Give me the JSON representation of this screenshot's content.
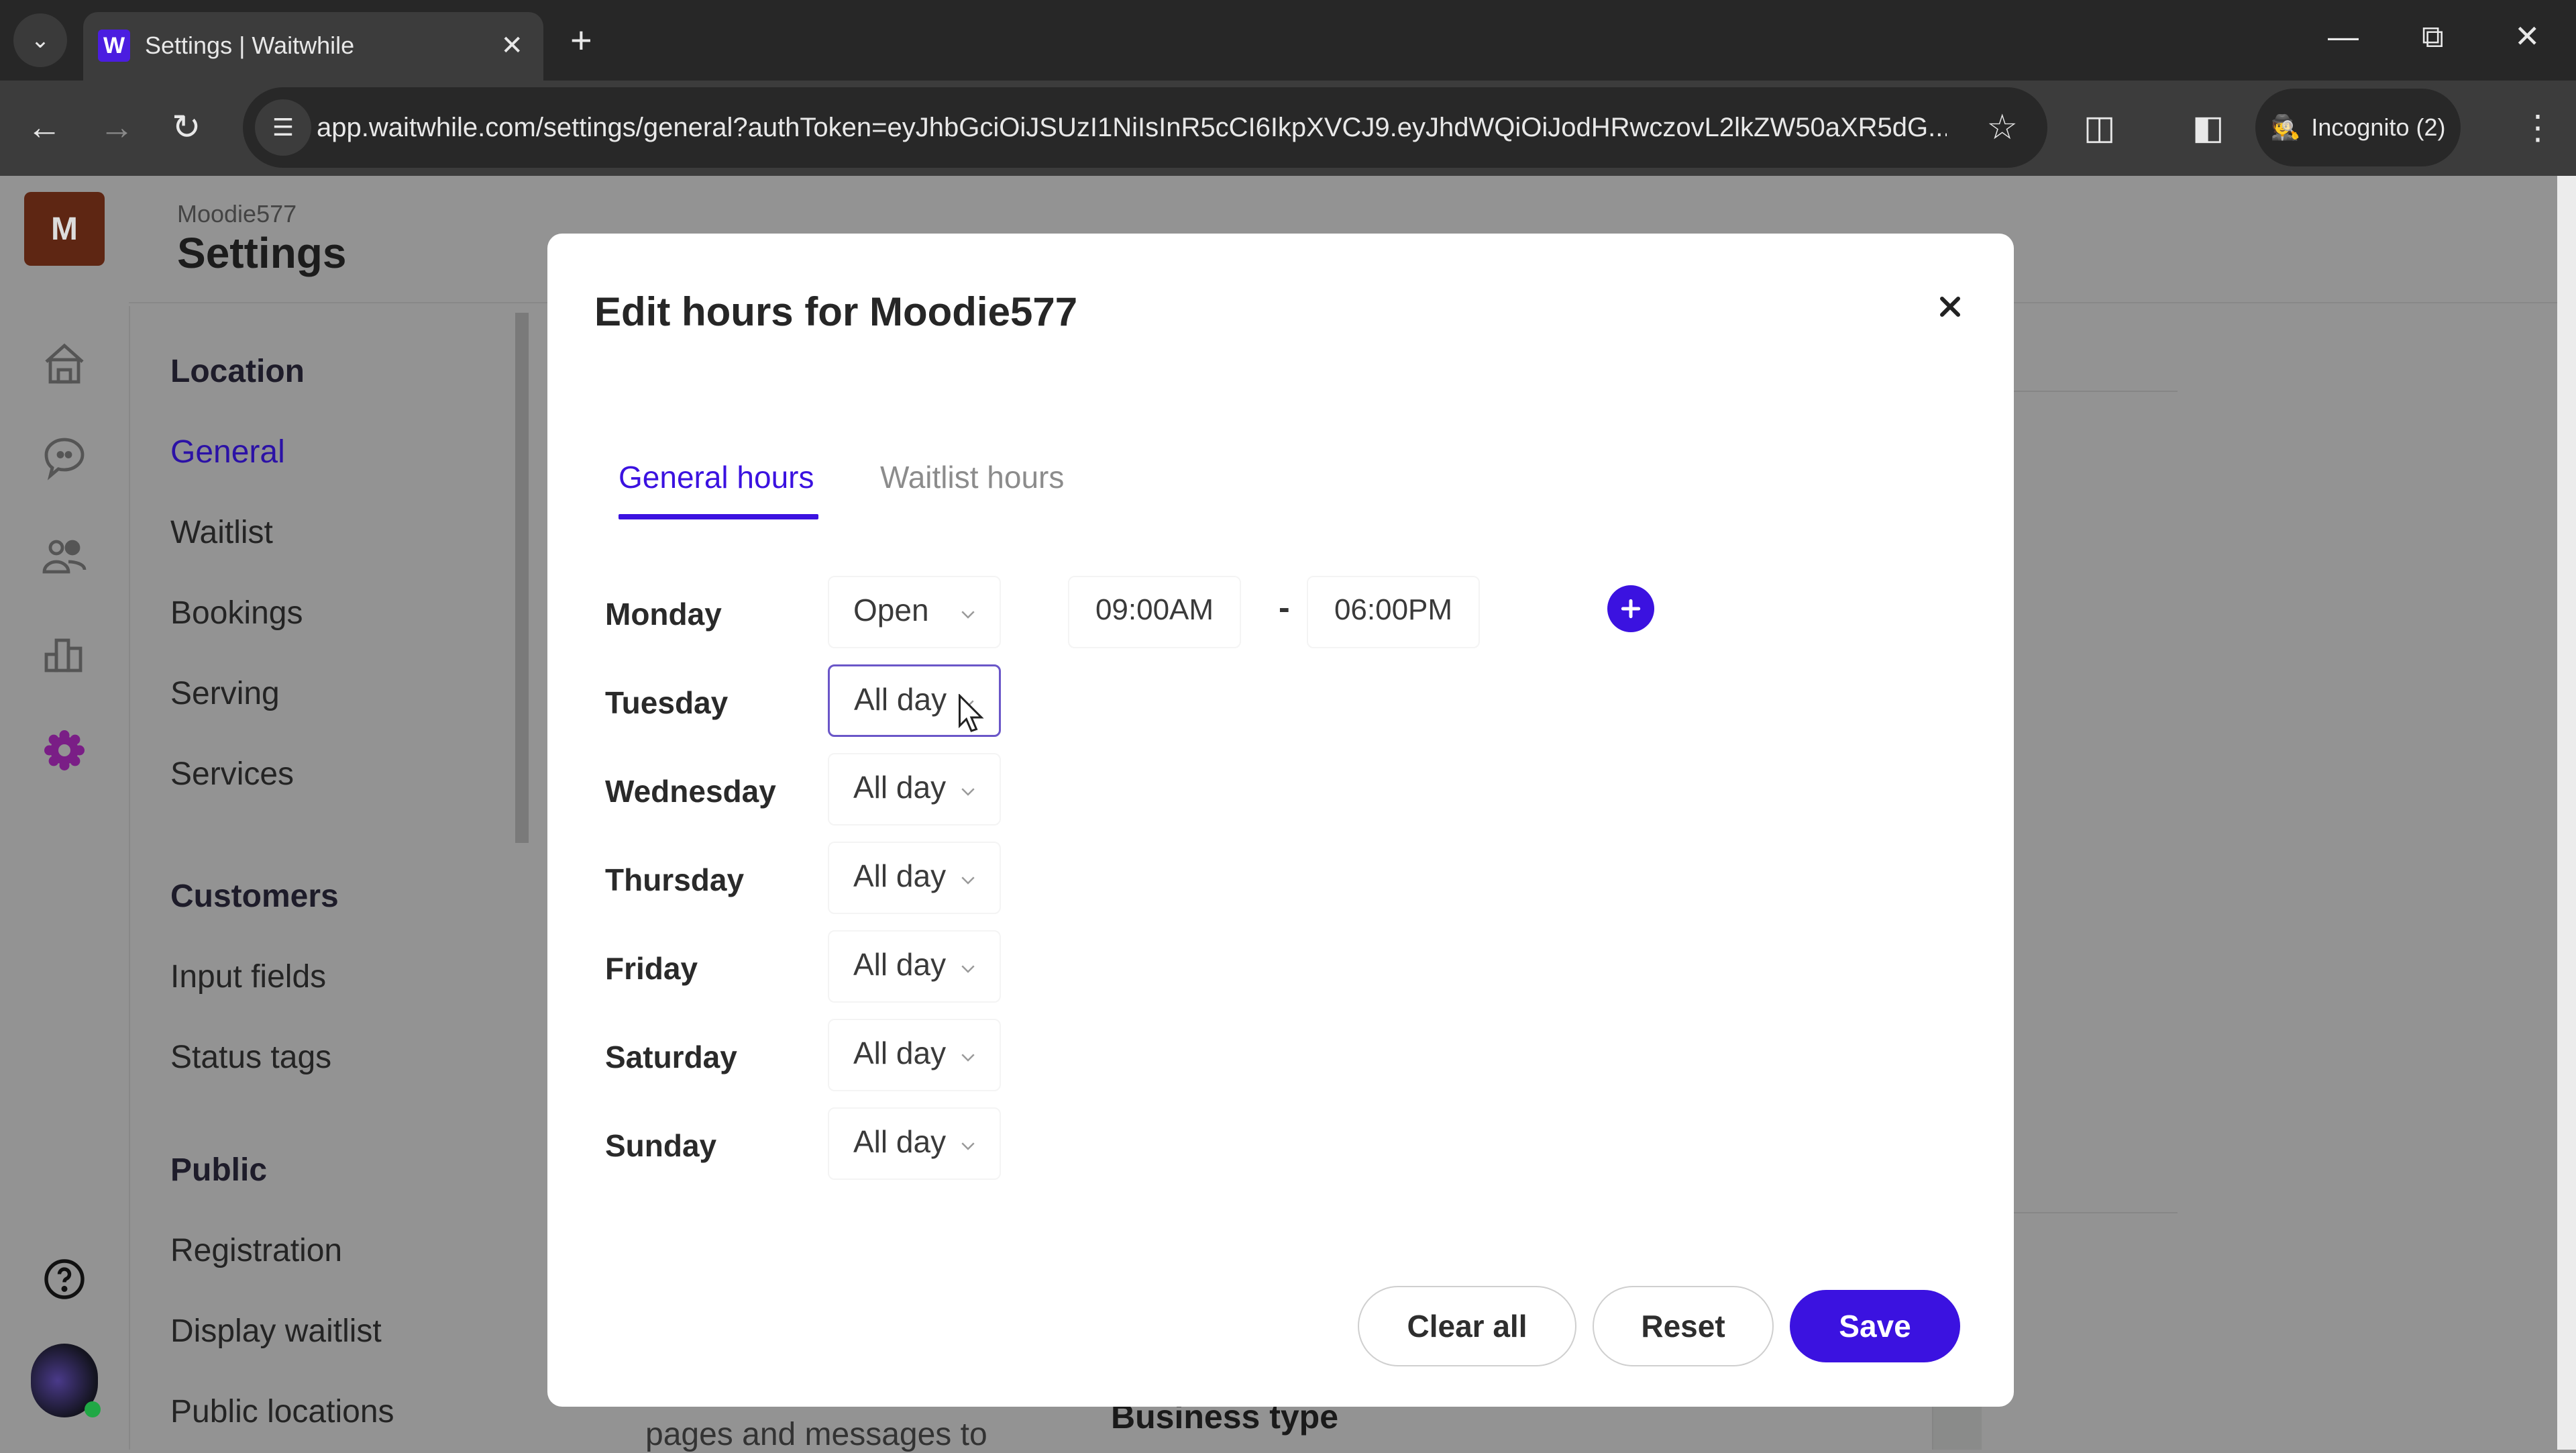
{
  "browser": {
    "tab_title": "Settings | Waitwhile",
    "favicon_letter": "W",
    "url": "app.waitwhile.com/settings/general?authToken=eyJhbGciOiJSUzI1NiIsInR5cCI6IkpXVCJ9.eyJhdWQiOiJodHRwczovL2lkZW50aXR5dG...",
    "incognito_label": "Incognito (2)",
    "icons": {
      "tab_menu": "chevron-down-icon",
      "close_tab": "close-icon",
      "new_tab": "plus-icon",
      "minimize": "minimize-icon",
      "restore": "restore-icon",
      "close_window": "close-icon",
      "back": "back-arrow-icon",
      "forward": "forward-arrow-icon",
      "reload": "reload-icon",
      "site_info": "tune-icon",
      "bookmark": "star-icon",
      "extensions": "puzzle-icon",
      "side_panel": "side-panel-icon",
      "incognito": "incognito-icon",
      "menu": "kebab-menu-icon"
    }
  },
  "app": {
    "account_initial": "M",
    "location_name": "Moodie577",
    "page_title": "Settings",
    "rail_icons": [
      "home-icon",
      "chat-icon",
      "customers-icon",
      "analytics-icon",
      "settings-icon",
      "help-icon"
    ],
    "accent_color": "#3b12e0",
    "nav": {
      "groups": [
        {
          "label": "Location",
          "items": [
            "General",
            "Waitlist",
            "Bookings",
            "Serving",
            "Services"
          ]
        },
        {
          "label": "Customers",
          "items": [
            "Input fields",
            "Status tags"
          ]
        },
        {
          "label": "Public",
          "items": [
            "Registration",
            "Display waitlist",
            "Public locations"
          ]
        }
      ],
      "active_item": "General"
    },
    "background_text": {
      "partial_desc": "pages and messages to",
      "business_type": "Business type"
    }
  },
  "modal": {
    "title": "Edit hours for Moodie577",
    "tabs": [
      {
        "label": "General hours",
        "active": true
      },
      {
        "label": "Waitlist hours",
        "active": false
      }
    ],
    "days": [
      {
        "day": "Monday",
        "mode": "Open",
        "open": "09:00AM",
        "separator": "-",
        "close": "06:00PM"
      },
      {
        "day": "Tuesday",
        "mode": "All day"
      },
      {
        "day": "Wednesday",
        "mode": "All day"
      },
      {
        "day": "Thursday",
        "mode": "All day"
      },
      {
        "day": "Friday",
        "mode": "All day"
      },
      {
        "day": "Saturday",
        "mode": "All day"
      },
      {
        "day": "Sunday",
        "mode": "All day"
      }
    ],
    "buttons": {
      "clear_all": "Clear all",
      "reset": "Reset",
      "save": "Save"
    }
  }
}
